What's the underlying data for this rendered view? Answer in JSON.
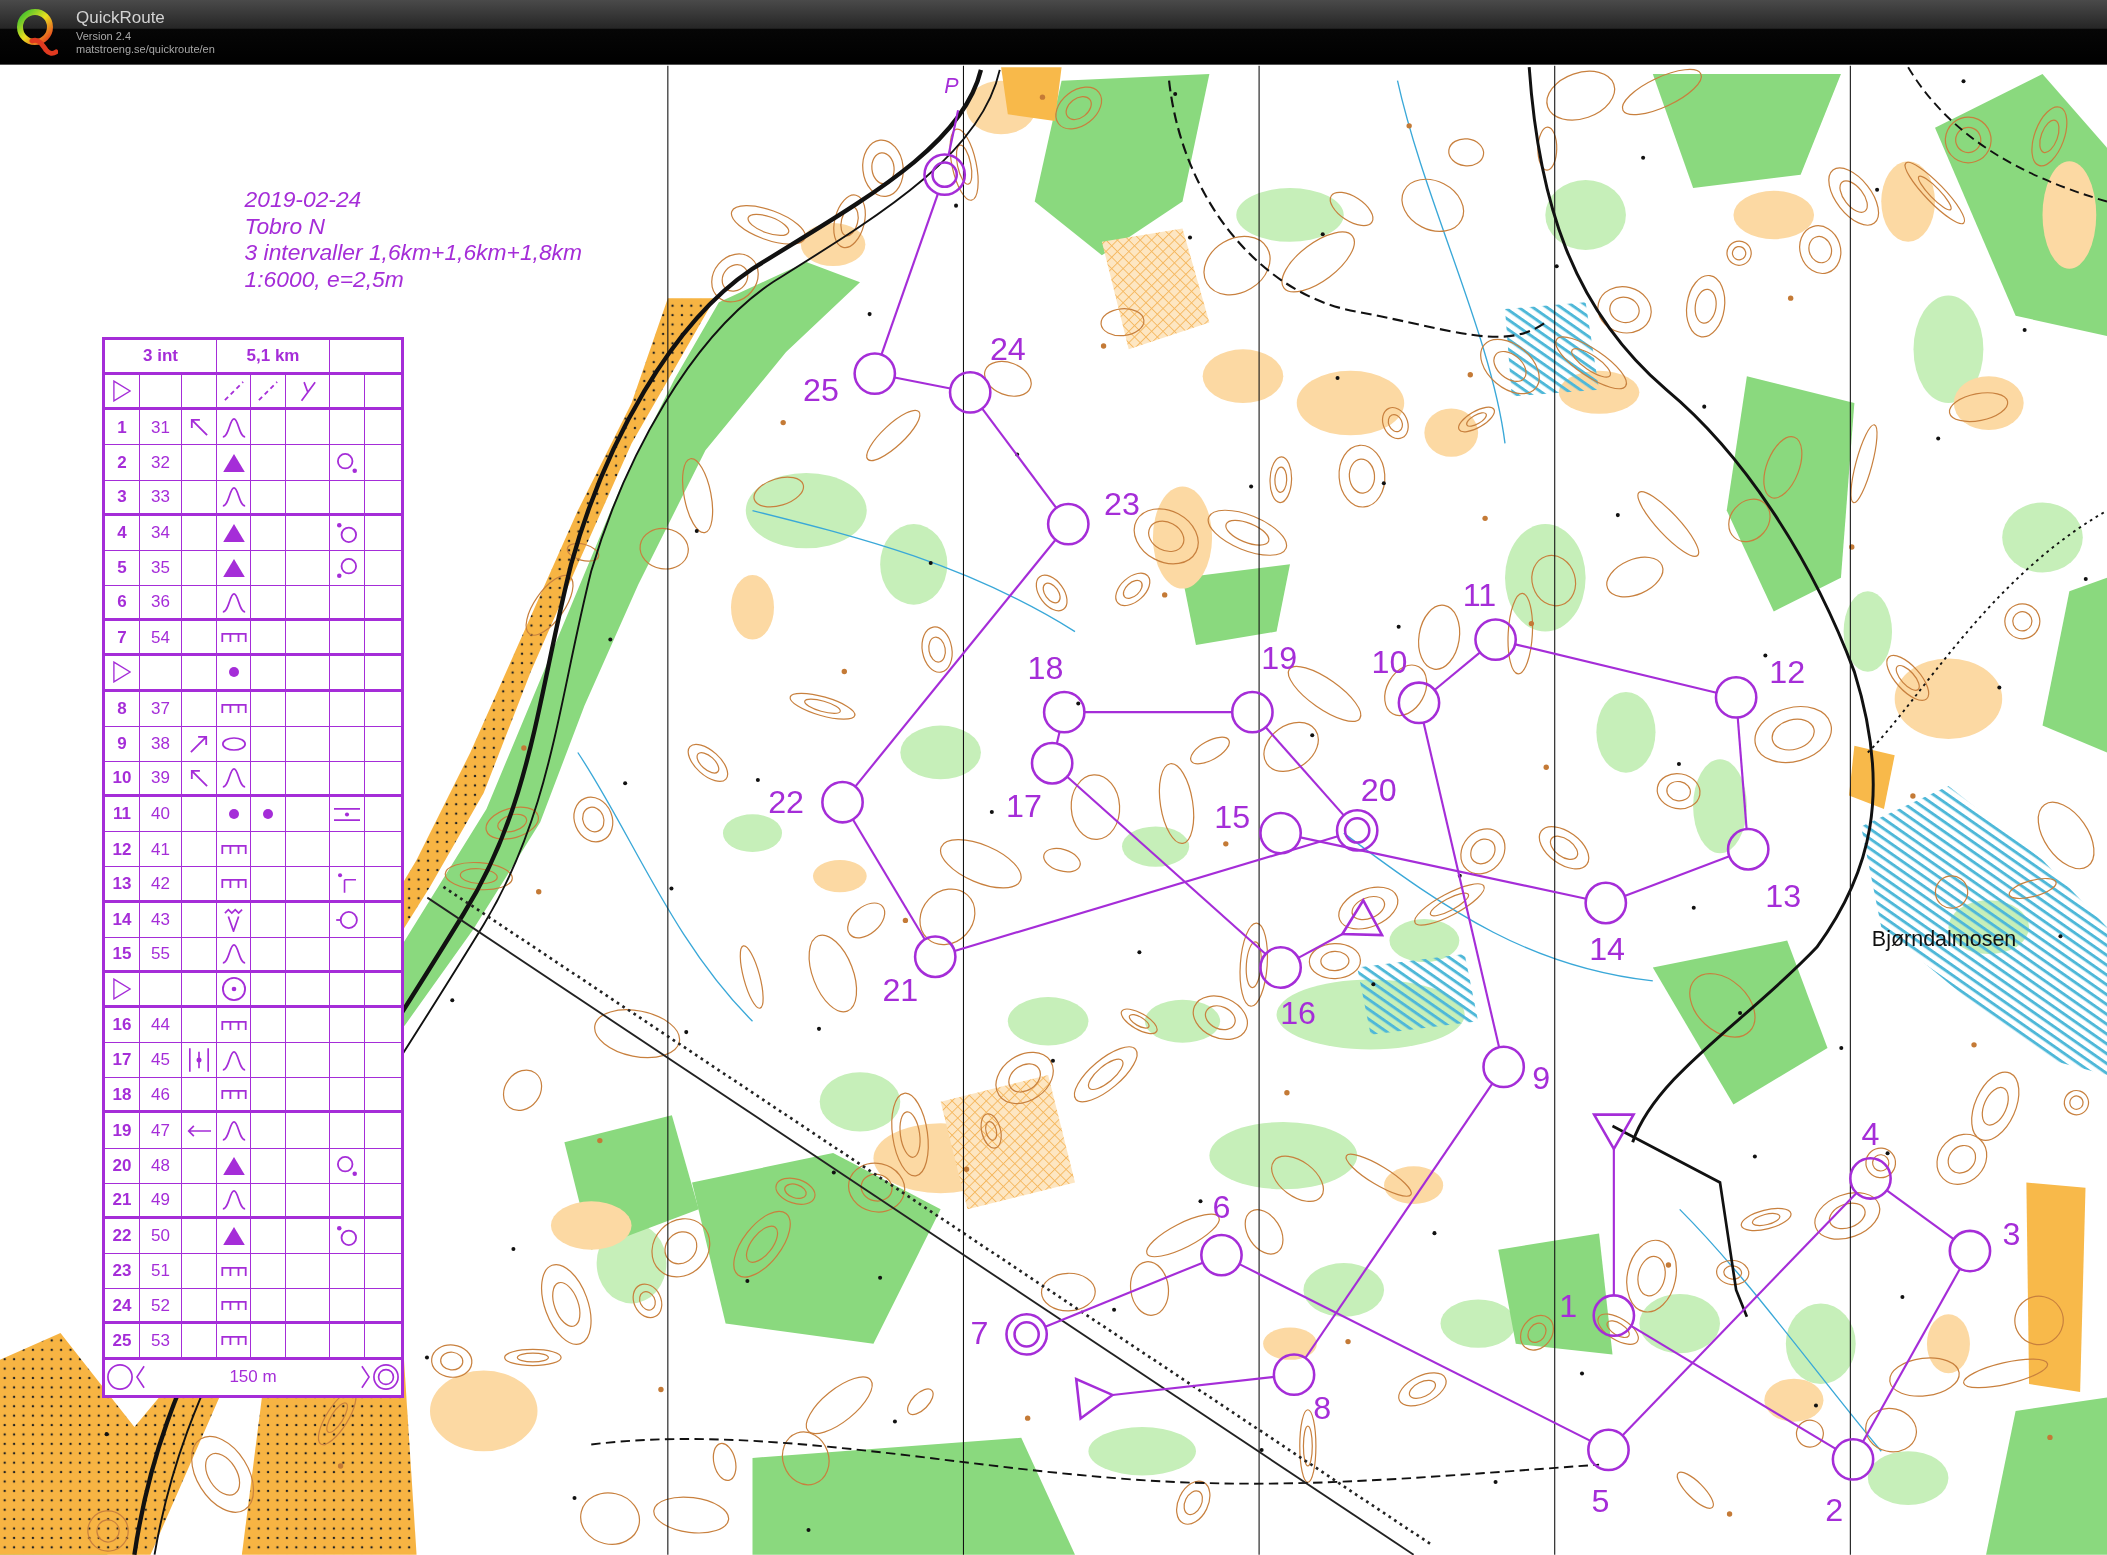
{
  "app_header": {
    "title": "QuickRoute",
    "version": "Version 2.4",
    "url": "matstroeng.se/quickroute/en"
  },
  "map": {
    "notes": [
      "2019-02-24",
      "Tobro N",
      "3 intervaller 1,6km+1,6km+1,8km",
      "1:6000, e=2,5m"
    ],
    "labels": [
      {
        "kind": "overprint",
        "text": "P"
      },
      {
        "kind": "place",
        "text": "Bjørndalmosen"
      }
    ],
    "course": {
      "intervals": [
        {
          "points": [
            {
              "kind": "start"
            },
            {
              "kind": "control",
              "number": "1"
            },
            {
              "kind": "control",
              "number": "2"
            },
            {
              "kind": "control",
              "number": "3"
            },
            {
              "kind": "control",
              "number": "4"
            },
            {
              "kind": "control",
              "number": "5"
            },
            {
              "kind": "control",
              "number": "6"
            },
            {
              "kind": "finish",
              "number": "7"
            }
          ]
        },
        {
          "points": [
            {
              "kind": "start"
            },
            {
              "kind": "control",
              "number": "8"
            },
            {
              "kind": "control",
              "number": "9"
            },
            {
              "kind": "control",
              "number": "10"
            },
            {
              "kind": "control",
              "number": "11"
            },
            {
              "kind": "control",
              "number": "12"
            },
            {
              "kind": "control",
              "number": "13"
            },
            {
              "kind": "control",
              "number": "14"
            },
            {
              "kind": "control",
              "number": "15"
            }
          ]
        },
        {
          "points": [
            {
              "kind": "start"
            },
            {
              "kind": "control",
              "number": "16"
            },
            {
              "kind": "control",
              "number": "17"
            },
            {
              "kind": "control",
              "number": "18"
            },
            {
              "kind": "control",
              "number": "19"
            },
            {
              "kind": "finish",
              "number": "20"
            },
            {
              "kind": "control",
              "number": "21"
            },
            {
              "kind": "control",
              "number": "22"
            },
            {
              "kind": "control",
              "number": "23"
            },
            {
              "kind": "control",
              "number": "24"
            },
            {
              "kind": "control",
              "number": "25"
            },
            {
              "kind": "finish"
            }
          ]
        }
      ]
    },
    "description_sheet": {
      "course_name": "3 int",
      "length": "5,1 km",
      "rows": [
        {
          "kind": "start",
          "column_d": {
            "kind": "dashed-line"
          },
          "column_e": {
            "kind": "dashed-line"
          },
          "column_f": {
            "kind": "fork"
          }
        },
        {
          "kind": "control",
          "number": "1",
          "code": "31",
          "column_c": {
            "kind": "arrow-nw"
          },
          "column_d": {
            "kind": "knoll"
          }
        },
        {
          "kind": "control",
          "number": "2",
          "code": "32",
          "column_d": {
            "kind": "boulder"
          },
          "column_g": {
            "kind": "ring-dot-se"
          }
        },
        {
          "kind": "control",
          "number": "3",
          "code": "33",
          "column_d": {
            "kind": "knoll"
          }
        },
        {
          "kind": "control",
          "number": "4",
          "code": "34",
          "column_d": {
            "kind": "boulder"
          },
          "column_g": {
            "kind": "ring-dot-nw"
          }
        },
        {
          "kind": "control",
          "number": "5",
          "code": "35",
          "column_d": {
            "kind": "boulder"
          },
          "column_g": {
            "kind": "ring-dot-sw"
          }
        },
        {
          "kind": "control",
          "number": "6",
          "code": "36",
          "column_d": {
            "kind": "knoll"
          }
        },
        {
          "kind": "control",
          "number": "7",
          "code": "54",
          "column_d": {
            "kind": "fence"
          }
        },
        {
          "kind": "start",
          "column_d": {
            "kind": "dot"
          }
        },
        {
          "kind": "control",
          "number": "8",
          "code": "37",
          "column_d": {
            "kind": "fence"
          }
        },
        {
          "kind": "control",
          "number": "9",
          "code": "38",
          "column_c": {
            "kind": "arrow-ne"
          },
          "column_d": {
            "kind": "ellipse"
          }
        },
        {
          "kind": "control",
          "number": "10",
          "code": "39",
          "column_c": {
            "kind": "arrow-nw"
          },
          "column_d": {
            "kind": "knoll"
          }
        },
        {
          "kind": "control",
          "number": "11",
          "code": "40",
          "column_d": {
            "kind": "dot"
          },
          "column_e": {
            "kind": "dot"
          },
          "column_g": {
            "kind": "between-lines"
          }
        },
        {
          "kind": "control",
          "number": "12",
          "code": "41",
          "column_d": {
            "kind": "fence"
          }
        },
        {
          "kind": "control",
          "number": "13",
          "code": "42",
          "column_d": {
            "kind": "fence"
          },
          "column_g": {
            "kind": "corner"
          }
        },
        {
          "kind": "control",
          "number": "14",
          "code": "43",
          "column_d": {
            "kind": "zigzag-v"
          },
          "column_g": {
            "kind": "ring-tick-w"
          }
        },
        {
          "kind": "control",
          "number": "15",
          "code": "55",
          "column_d": {
            "kind": "knoll"
          }
        },
        {
          "kind": "start",
          "column_d": {
            "kind": "circle-dot"
          }
        },
        {
          "kind": "control",
          "number": "16",
          "code": "44",
          "column_d": {
            "kind": "fence"
          }
        },
        {
          "kind": "control",
          "number": "17",
          "code": "45",
          "column_c": {
            "kind": "bars-dot"
          },
          "column_d": {
            "kind": "knoll"
          }
        },
        {
          "kind": "control",
          "number": "18",
          "code": "46",
          "column_d": {
            "kind": "fence"
          }
        },
        {
          "kind": "control",
          "number": "19",
          "code": "47",
          "column_c": {
            "kind": "arrow-w"
          },
          "column_d": {
            "kind": "knoll"
          }
        },
        {
          "kind": "control",
          "number": "20",
          "code": "48",
          "column_d": {
            "kind": "boulder"
          },
          "column_g": {
            "kind": "ring-dot-se"
          }
        },
        {
          "kind": "control",
          "number": "21",
          "code": "49",
          "column_d": {
            "kind": "knoll"
          }
        },
        {
          "kind": "control",
          "number": "22",
          "code": "50",
          "column_d": {
            "kind": "boulder"
          },
          "column_g": {
            "kind": "ring-dot-nw"
          }
        },
        {
          "kind": "control",
          "number": "23",
          "code": "51",
          "column_d": {
            "kind": "fence"
          }
        },
        {
          "kind": "control",
          "number": "24",
          "code": "52",
          "column_d": {
            "kind": "fence"
          }
        },
        {
          "kind": "control",
          "number": "25",
          "code": "53",
          "column_d": {
            "kind": "fence"
          }
        },
        {
          "kind": "finish",
          "distance": "150 m"
        }
      ]
    }
  }
}
